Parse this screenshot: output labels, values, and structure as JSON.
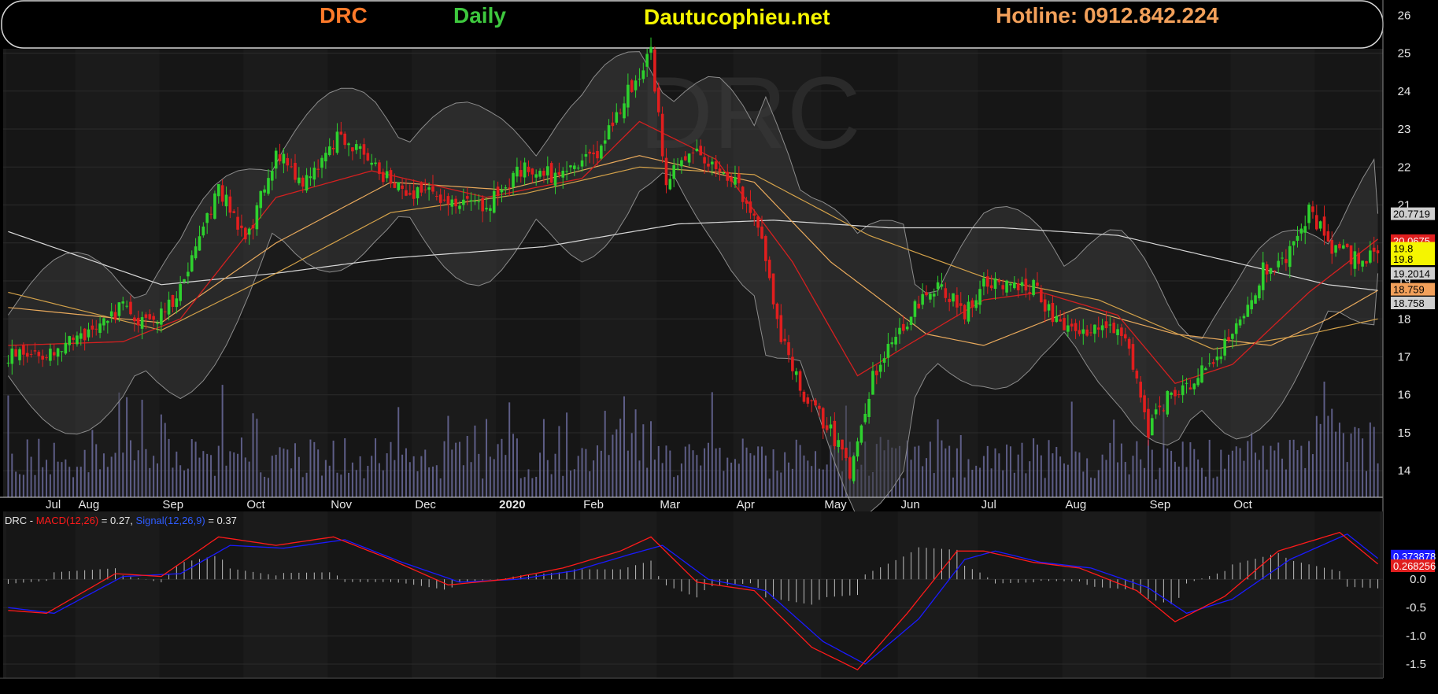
{
  "header": {
    "symbol": "DRC",
    "period": "Daily",
    "site": "Dautucophieu.net",
    "hotline": "Hotline: 0912.842.224"
  },
  "watermark": "DRC",
  "colors": {
    "background": "#000000",
    "panel": "#1b1b1b",
    "up": "#2ed12e",
    "down": "#e01e1e",
    "ma20": "#d42020",
    "ma50": "#e8a95c",
    "ma100": "#d4a24a",
    "ma200": "#d8d8d8",
    "bollinger": "#8c8c8c",
    "volume": "#6a6a9a",
    "macd": "#ff1a1a",
    "signal": "#1a1aff",
    "symbol_text": "#ff7a2a",
    "period_text": "#3ec83e",
    "site_text": "#f5f500",
    "hotline_text": "#f2a05a"
  },
  "chart_data": [
    {
      "type": "candlestick",
      "title": "DRC Daily",
      "x_labels": [
        "Jul",
        "Aug",
        "Sep",
        "Oct",
        "Nov",
        "Dec",
        "2020",
        "Feb",
        "Mar",
        "Apr",
        "May",
        "Jun",
        "Jul",
        "Aug",
        "Sep",
        "Oct"
      ],
      "ylim": [
        13.3,
        26.4
      ],
      "y_ticks": [
        14,
        15,
        16,
        17,
        18,
        19,
        20,
        21,
        22,
        23,
        24,
        25,
        26
      ],
      "grid": true,
      "close_path": [
        [
          0,
          17.0
        ],
        [
          10,
          17.0
        ],
        [
          20,
          17.6
        ],
        [
          30,
          18.3
        ],
        [
          38,
          17.8
        ],
        [
          45,
          18.8
        ],
        [
          55,
          21.5
        ],
        [
          62,
          20.0
        ],
        [
          70,
          22.3
        ],
        [
          78,
          21.6
        ],
        [
          87,
          22.9
        ],
        [
          95,
          22.0
        ],
        [
          105,
          21.3
        ],
        [
          115,
          21.2
        ],
        [
          125,
          21.0
        ],
        [
          135,
          22.0
        ],
        [
          145,
          21.7
        ],
        [
          155,
          22.5
        ],
        [
          162,
          24.0
        ],
        [
          168,
          25.0
        ],
        [
          172,
          21.5
        ],
        [
          178,
          22.5
        ],
        [
          184,
          22.0
        ],
        [
          190,
          21.6
        ],
        [
          196,
          20.5
        ],
        [
          202,
          17.5
        ],
        [
          208,
          16.0
        ],
        [
          214,
          15.2
        ],
        [
          220,
          14.0
        ],
        [
          226,
          16.5
        ],
        [
          232,
          17.5
        ],
        [
          238,
          18.5
        ],
        [
          244,
          18.8
        ],
        [
          250,
          18.2
        ],
        [
          256,
          19.0
        ],
        [
          262,
          18.9
        ],
        [
          268,
          18.8
        ],
        [
          274,
          18.0
        ],
        [
          280,
          17.6
        ],
        [
          286,
          17.9
        ],
        [
          292,
          17.6
        ],
        [
          298,
          15.0
        ],
        [
          303,
          16.0
        ],
        [
          310,
          16.4
        ],
        [
          316,
          17.0
        ],
        [
          322,
          17.8
        ],
        [
          328,
          19.3
        ],
        [
          334,
          19.5
        ],
        [
          340,
          20.9
        ],
        [
          346,
          19.8
        ],
        [
          353,
          19.6
        ],
        [
          358,
          19.8
        ]
      ],
      "overlays": {
        "ma20": [
          [
            0,
            17.3
          ],
          [
            30,
            17.4
          ],
          [
            45,
            18.0
          ],
          [
            70,
            21.2
          ],
          [
            95,
            21.9
          ],
          [
            125,
            21.2
          ],
          [
            150,
            21.7
          ],
          [
            165,
            23.2
          ],
          [
            185,
            22.2
          ],
          [
            205,
            19.5
          ],
          [
            222,
            16.5
          ],
          [
            235,
            17.3
          ],
          [
            255,
            18.5
          ],
          [
            270,
            18.7
          ],
          [
            290,
            18.1
          ],
          [
            305,
            16.3
          ],
          [
            320,
            16.8
          ],
          [
            340,
            18.7
          ],
          [
            358,
            20.1
          ]
        ],
        "ma50": [
          [
            0,
            18.3
          ],
          [
            40,
            17.9
          ],
          [
            70,
            20.0
          ],
          [
            100,
            21.6
          ],
          [
            130,
            21.4
          ],
          [
            165,
            22.3
          ],
          [
            195,
            21.6
          ],
          [
            215,
            19.5
          ],
          [
            240,
            17.6
          ],
          [
            255,
            17.3
          ],
          [
            280,
            18.3
          ],
          [
            305,
            17.6
          ],
          [
            330,
            17.3
          ],
          [
            345,
            18.0
          ],
          [
            358,
            18.75
          ]
        ],
        "ma100": [
          [
            0,
            18.7
          ],
          [
            40,
            17.7
          ],
          [
            70,
            19.2
          ],
          [
            100,
            20.8
          ],
          [
            135,
            21.3
          ],
          [
            165,
            22.0
          ],
          [
            195,
            21.8
          ],
          [
            225,
            20.2
          ],
          [
            255,
            19.1
          ],
          [
            285,
            18.5
          ],
          [
            315,
            17.2
          ],
          [
            340,
            17.6
          ],
          [
            358,
            18.0
          ]
        ],
        "ma200": [
          [
            0,
            20.3
          ],
          [
            40,
            18.9
          ],
          [
            70,
            19.2
          ],
          [
            100,
            19.6
          ],
          [
            140,
            19.9
          ],
          [
            175,
            20.5
          ],
          [
            200,
            20.6
          ],
          [
            230,
            20.4
          ],
          [
            260,
            20.4
          ],
          [
            290,
            20.2
          ],
          [
            320,
            19.5
          ],
          [
            345,
            18.9
          ],
          [
            358,
            18.75
          ]
        ]
      },
      "markers": {
        "bollinger_upper": "20.7719",
        "ma20": "20.0675",
        "close": "19.8",
        "last": "19.8",
        "bollinger_lower": "19.2014",
        "ma50": "18.759",
        "ma200": "18.758"
      }
    },
    {
      "type": "line",
      "title": "DRC - MACD(12,26) = 0.27, Signal(12,26,9) = 0.37",
      "ylim": [
        -1.75,
        1.2
      ],
      "y_ticks": [
        -1.5,
        -1.0,
        -0.5,
        0.0
      ],
      "y_tick_labels": [
        "-1.5",
        "-1.0",
        "-0.5",
        "0.0"
      ],
      "series": [
        {
          "name": "MACD(12,26)",
          "value": "0.27",
          "points": [
            [
              0,
              -0.55
            ],
            [
              10,
              -0.6
            ],
            [
              28,
              0.1
            ],
            [
              40,
              0.05
            ],
            [
              55,
              0.75
            ],
            [
              70,
              0.6
            ],
            [
              85,
              0.75
            ],
            [
              100,
              0.35
            ],
            [
              115,
              -0.1
            ],
            [
              130,
              0.0
            ],
            [
              145,
              0.2
            ],
            [
              160,
              0.5
            ],
            [
              168,
              0.75
            ],
            [
              180,
              -0.05
            ],
            [
              195,
              -0.2
            ],
            [
              210,
              -1.2
            ],
            [
              222,
              -1.6
            ],
            [
              235,
              -0.6
            ],
            [
              248,
              0.5
            ],
            [
              255,
              0.5
            ],
            [
              268,
              0.3
            ],
            [
              280,
              0.2
            ],
            [
              295,
              -0.2
            ],
            [
              305,
              -0.75
            ],
            [
              318,
              -0.3
            ],
            [
              332,
              0.5
            ],
            [
              348,
              0.83
            ],
            [
              358,
              0.27
            ]
          ]
        },
        {
          "name": "Signal(12,26,9)",
          "value": "0.37",
          "points": [
            [
              0,
              -0.5
            ],
            [
              12,
              -0.6
            ],
            [
              30,
              0.05
            ],
            [
              45,
              0.1
            ],
            [
              58,
              0.6
            ],
            [
              72,
              0.55
            ],
            [
              88,
              0.7
            ],
            [
              103,
              0.3
            ],
            [
              118,
              -0.05
            ],
            [
              133,
              0.0
            ],
            [
              148,
              0.15
            ],
            [
              163,
              0.45
            ],
            [
              171,
              0.6
            ],
            [
              183,
              0.0
            ],
            [
              198,
              -0.2
            ],
            [
              213,
              -1.1
            ],
            [
              224,
              -1.5
            ],
            [
              238,
              -0.7
            ],
            [
              250,
              0.35
            ],
            [
              258,
              0.5
            ],
            [
              270,
              0.3
            ],
            [
              283,
              0.2
            ],
            [
              298,
              -0.15
            ],
            [
              308,
              -0.6
            ],
            [
              320,
              -0.35
            ],
            [
              335,
              0.35
            ],
            [
              350,
              0.8
            ],
            [
              358,
              0.37
            ]
          ]
        }
      ],
      "markers": {
        "signal": "0.373878",
        "macd": "0.268256"
      }
    }
  ]
}
